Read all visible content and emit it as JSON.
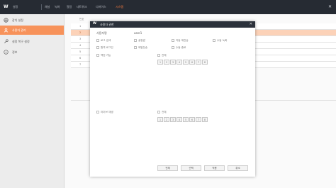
{
  "topbar": {
    "logo": "W",
    "menu": [
      "설정",
      "채널",
      "녹화",
      "알람",
      "네트워크",
      "디바이스",
      "시스템"
    ],
    "active_menu_index": 6,
    "close_icon": "close-icon"
  },
  "sidebar": {
    "items": [
      {
        "label": "장치 설정",
        "icon": "globe-icon"
      },
      {
        "label": "사용자 관리",
        "icon": "user-icon"
      },
      {
        "label": "설정 복구 설정",
        "icon": "wrench-icon"
      },
      {
        "label": "정보",
        "icon": "info-icon"
      }
    ],
    "active_index": 1
  },
  "table": {
    "header_num": "번호",
    "rows": [
      "1",
      "2",
      "3",
      "4",
      "5",
      "6",
      "7"
    ],
    "selected_index": 1
  },
  "modal": {
    "logo": "W",
    "title": "사용자 권한",
    "username_label": "사용자명",
    "username_value": "user1",
    "perms_row1": [
      "로그 검색",
      "설정값",
      "자동 재전송",
      "수동 녹화"
    ],
    "perms_row2": [
      "원격 로그인",
      "메일전송",
      "수동 종료"
    ],
    "backup_label": "백업 가능",
    "all_label_1": "전체",
    "channels_1": [
      "1",
      "2",
      "3",
      "4",
      "5",
      "6",
      "7",
      "8"
    ],
    "live_label": "라이브 재생",
    "all_label_2": "전체",
    "channels_2": [
      "1",
      "2",
      "3",
      "4",
      "5",
      "6",
      "7",
      "8"
    ],
    "buttons": [
      "전체",
      "선택",
      "적용",
      "취소"
    ]
  }
}
